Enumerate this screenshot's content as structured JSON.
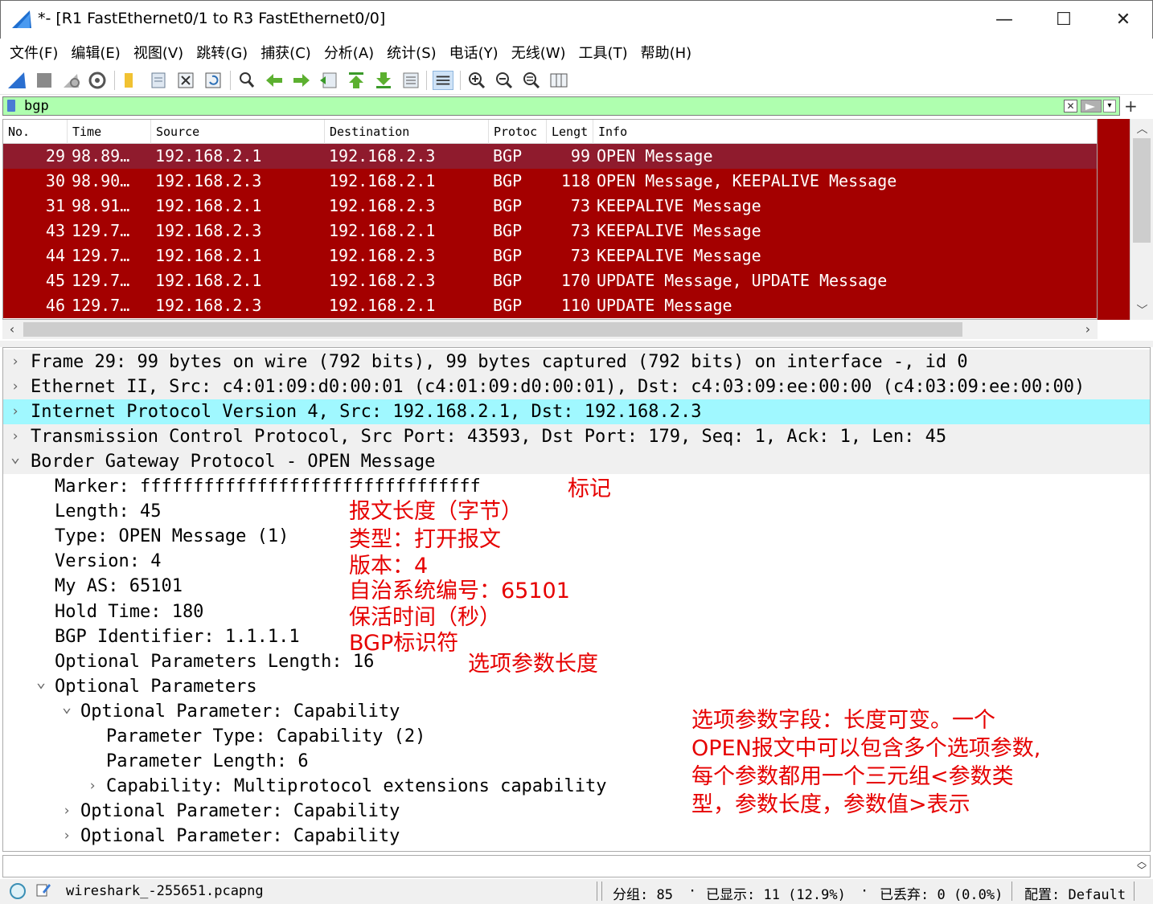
{
  "window": {
    "title": "*- [R1 FastEthernet0/1 to R3 FastEthernet0/0]",
    "minimize": "—",
    "maximize": "☐",
    "close": "✕"
  },
  "menu": [
    "文件(F)",
    "编辑(E)",
    "视图(V)",
    "跳转(G)",
    "捕获(C)",
    "分析(A)",
    "统计(S)",
    "电话(Y)",
    "无线(W)",
    "工具(T)",
    "帮助(H)"
  ],
  "filter": {
    "value": "bgp",
    "plus": "+"
  },
  "packet_list": {
    "columns": [
      "No.",
      "Time",
      "Source",
      "Destination",
      "Protoc",
      "Lengt",
      "Info"
    ],
    "rows": [
      {
        "no": "29",
        "time": "98.89…",
        "src": "192.168.2.1",
        "dst": "192.168.2.3",
        "proto": "BGP",
        "len": "99",
        "info": "OPEN Message",
        "selected": true
      },
      {
        "no": "30",
        "time": "98.90…",
        "src": "192.168.2.3",
        "dst": "192.168.2.1",
        "proto": "BGP",
        "len": "118",
        "info": "OPEN Message, KEEPALIVE Message"
      },
      {
        "no": "31",
        "time": "98.91…",
        "src": "192.168.2.1",
        "dst": "192.168.2.3",
        "proto": "BGP",
        "len": "73",
        "info": "KEEPALIVE Message"
      },
      {
        "no": "43",
        "time": "129.7…",
        "src": "192.168.2.3",
        "dst": "192.168.2.1",
        "proto": "BGP",
        "len": "73",
        "info": "KEEPALIVE Message"
      },
      {
        "no": "44",
        "time": "129.7…",
        "src": "192.168.2.1",
        "dst": "192.168.2.3",
        "proto": "BGP",
        "len": "73",
        "info": "KEEPALIVE Message"
      },
      {
        "no": "45",
        "time": "129.7…",
        "src": "192.168.2.1",
        "dst": "192.168.2.3",
        "proto": "BGP",
        "len": "170",
        "info": "UPDATE Message, UPDATE Message"
      },
      {
        "no": "46",
        "time": "129.7…",
        "src": "192.168.2.3",
        "dst": "192.168.2.1",
        "proto": "BGP",
        "len": "110",
        "info": "UPDATE Message"
      }
    ],
    "row_color": "#a40000",
    "selected_color": "#8f1b2d"
  },
  "details": [
    {
      "text": "Frame 29: 99 bytes on wire (792 bits), 99 bytes captured (792 bits) on interface -, id 0",
      "chevron": ">",
      "style": "top"
    },
    {
      "text": "Ethernet II, Src: c4:01:09:d0:00:01 (c4:01:09:d0:00:01), Dst: c4:03:09:ee:00:00 (c4:03:09:ee:00:00)",
      "chevron": ">",
      "style": "top"
    },
    {
      "text": "Internet Protocol Version 4, Src: 192.168.2.1, Dst: 192.168.2.3",
      "chevron": ">",
      "style": "hl"
    },
    {
      "text": "Transmission Control Protocol, Src Port: 43593, Dst Port: 179, Seq: 1, Ack: 1, Len: 45",
      "chevron": ">",
      "style": "top"
    },
    {
      "text": "Border Gateway Protocol - OPEN Message",
      "chevron": "v",
      "style": "top"
    },
    {
      "text": "Marker: ffffffffffffffffffffffffffffffff",
      "chevron": ""
    },
    {
      "text": "Length: 45",
      "chevron": ""
    },
    {
      "text": "Type: OPEN Message (1)",
      "chevron": ""
    },
    {
      "text": "Version: 4",
      "chevron": ""
    },
    {
      "text": "My AS: 65101",
      "chevron": ""
    },
    {
      "text": "Hold Time: 180",
      "chevron": ""
    },
    {
      "text": "BGP Identifier: 1.1.1.1",
      "chevron": ""
    },
    {
      "text": "Optional Parameters Length: 16",
      "chevron": ""
    },
    {
      "text": "Optional Parameters",
      "chevron": "v"
    },
    {
      "text": "Optional Parameter: Capability",
      "chevron": "v"
    },
    {
      "text": "Parameter Type: Capability (2)",
      "chevron": ""
    },
    {
      "text": "Parameter Length: 6",
      "chevron": ""
    },
    {
      "text": "Capability: Multiprotocol extensions capability",
      "chevron": ">"
    },
    {
      "text": "Optional Parameter: Capability",
      "chevron": ">"
    },
    {
      "text": "Optional Parameter: Capability",
      "chevron": ">"
    }
  ],
  "annotations": {
    "marker": "标记",
    "length": "报文长度（字节）",
    "type": "类型：打开报文",
    "version": "版本：4",
    "my_as": "自治系统编号：65101",
    "hold_time": "保活时间（秒）",
    "bgp_id": "BGP标识符",
    "opt_len": "选项参数长度",
    "opt_desc_1": "选项参数字段：长度可变。一个",
    "opt_desc_2": "OPEN报文中可以包含多个选项参数,",
    "opt_desc_3": "每个参数都用一个三元组<参数类",
    "opt_desc_4": "型，参数长度，参数值>表示"
  },
  "statusbar": {
    "file": "wireshark_-255651.pcapng",
    "packets": "分组: 85",
    "displayed": "已显示: 11 (12.9%)",
    "dropped": "已丢弃: 0 (0.0%)",
    "profile": "配置: Default",
    "dot": "·"
  }
}
